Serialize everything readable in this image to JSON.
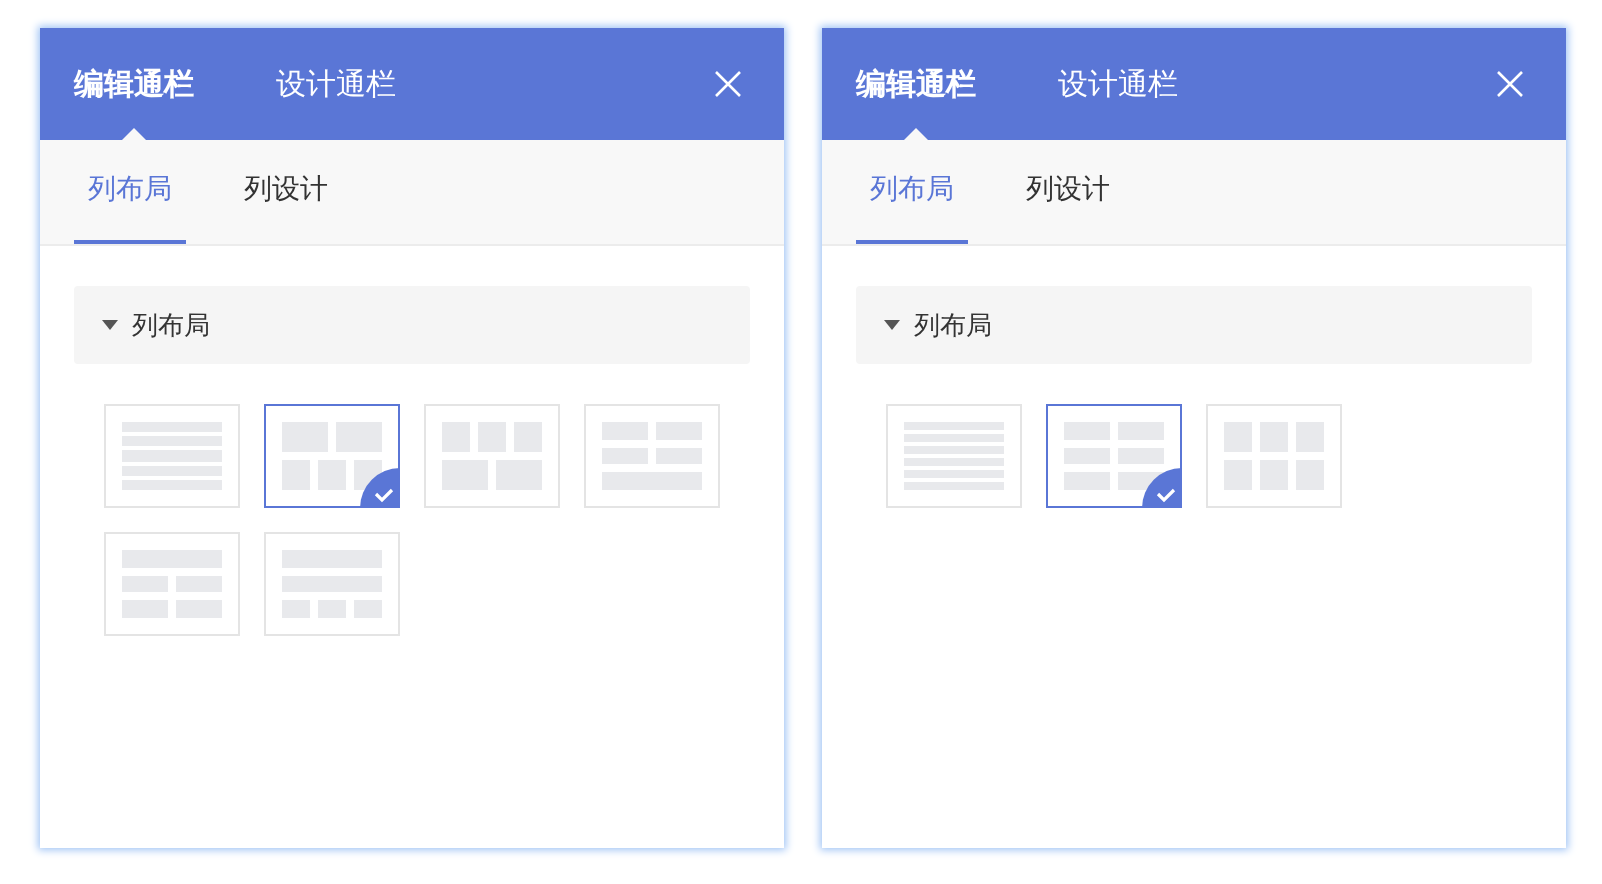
{
  "panels": [
    {
      "tabs": [
        {
          "label": "编辑通栏",
          "selected": true
        },
        {
          "label": "设计通栏",
          "selected": false
        }
      ],
      "subtabs": [
        {
          "label": "列布局",
          "selected": true
        },
        {
          "label": "列设计",
          "selected": false
        }
      ],
      "section": {
        "title": "列布局",
        "expanded": true
      },
      "layouts": [
        {
          "kind": "lines5",
          "selected": false
        },
        {
          "kind": "two-three",
          "selected": true
        },
        {
          "kind": "three-two",
          "selected": false
        },
        {
          "kind": "pairs-full",
          "selected": false
        },
        {
          "kind": "full-pairs",
          "selected": false
        },
        {
          "kind": "full-full-three",
          "selected": false
        }
      ]
    },
    {
      "tabs": [
        {
          "label": "编辑通栏",
          "selected": true
        },
        {
          "label": "设计通栏",
          "selected": false
        }
      ],
      "subtabs": [
        {
          "label": "列布局",
          "selected": true
        },
        {
          "label": "列设计",
          "selected": false
        }
      ],
      "section": {
        "title": "列布局",
        "expanded": true
      },
      "layouts": [
        {
          "kind": "lines6",
          "selected": false
        },
        {
          "kind": "pairs3",
          "selected": true
        },
        {
          "kind": "threes2",
          "selected": false
        }
      ]
    }
  ]
}
